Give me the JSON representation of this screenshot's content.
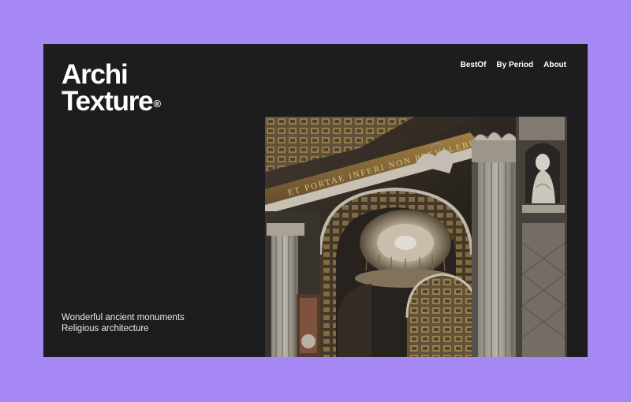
{
  "brand": {
    "line1": "Archi",
    "line2": "Texture",
    "mark": "®"
  },
  "nav": {
    "items": [
      "BestOf",
      "By Period",
      "About"
    ]
  },
  "caption": {
    "line1": "Wonderful ancient monuments",
    "line2": "Religious architecture"
  },
  "hero_image": {
    "inscription": "NON PREVALEBUNT ... NON PEVALEBI",
    "subject": "basilica-interior-arch-dome"
  },
  "colors": {
    "page_background": "#a688f4",
    "panel_background": "#1d1d20",
    "text": "#ffffff"
  }
}
